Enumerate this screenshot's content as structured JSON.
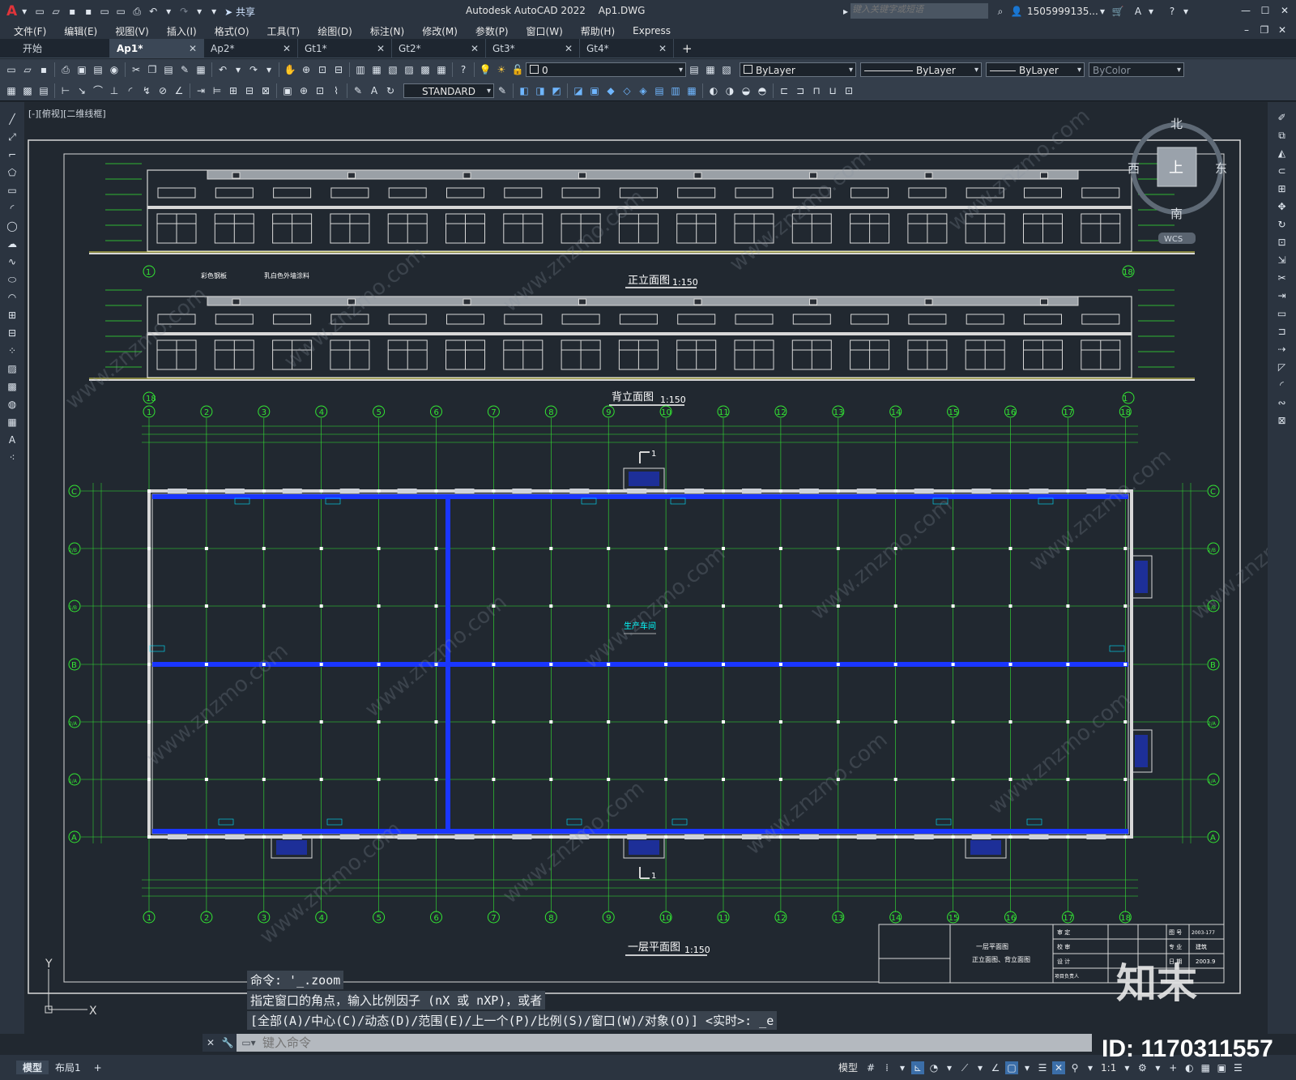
{
  "window": {
    "title": "Autodesk AutoCAD 2022",
    "file": "Ap1.DWG",
    "share": "共享",
    "search_placeholder": "键入关键字或短语",
    "user": "1505999135...",
    "app_letter": "A"
  },
  "menu": [
    "文件(F)",
    "编辑(E)",
    "视图(V)",
    "插入(I)",
    "格式(O)",
    "工具(T)",
    "绘图(D)",
    "标注(N)",
    "修改(M)",
    "参数(P)",
    "窗口(W)",
    "帮助(H)",
    "Express"
  ],
  "tabs": [
    {
      "label": "开始",
      "close": false,
      "active": false
    },
    {
      "label": "Ap1*",
      "close": true,
      "active": true
    },
    {
      "label": "Ap2*",
      "close": true,
      "active": false
    },
    {
      "label": "Gt1*",
      "close": true,
      "active": false
    },
    {
      "label": "Gt2*",
      "close": true,
      "active": false
    },
    {
      "label": "Gt3*",
      "close": true,
      "active": false
    },
    {
      "label": "Gt4*",
      "close": true,
      "active": false
    }
  ],
  "props": {
    "layer": "0",
    "color": "ByLayer",
    "linetype": "ByLayer",
    "lineweight": "ByLayer",
    "plotstyle": "ByColor",
    "textstyle": "STANDARD"
  },
  "view_label": "[-][俯视][二维线框]",
  "viewcube": {
    "n": "北",
    "s": "南",
    "e": "东",
    "w": "西",
    "top": "上",
    "wcs": "WCS"
  },
  "ucs": {
    "y": "Y",
    "x": "X"
  },
  "drawing": {
    "front_title": "正立面图",
    "front_scale": "1:150",
    "back_title": "背立面图",
    "back_scale": "1:150",
    "plan_title": "一层平面图",
    "plan_scale": "1:150",
    "room_label": "生产车间",
    "section_mark": "1",
    "axis_numbers": [
      "1",
      "2",
      "3",
      "4",
      "5",
      "6",
      "7",
      "8",
      "9",
      "10",
      "11",
      "12",
      "13",
      "14",
      "15",
      "16",
      "17",
      "18"
    ],
    "axis_letters": [
      "C",
      "2/B",
      "1/B",
      "B",
      "2/A",
      "1/A",
      "A"
    ],
    "elev_axis_start": "1",
    "elev_axis_end": "18",
    "note1": "彩色钢板",
    "note2": "乳白色外墙涂料",
    "title_block": {
      "drawing_name_1": "一层平面图",
      "drawing_name_2": "正立面图、背立面图",
      "no_label": "图 号",
      "no_value": "2003-177",
      "spec_label": "专 业",
      "spec_value": "建筑",
      "date_label": "日 期",
      "date_value": "2003.9",
      "approve": "审 定",
      "check": "校 审",
      "design": "设 计",
      "lead": "项目负责人"
    }
  },
  "command": {
    "history": [
      "命令: '_.zoom",
      "指定窗口的角点，输入比例因子 (nX 或 nXP)，或者",
      "[全部(A)/中心(C)/动态(D)/范围(E)/上一个(P)/比例(S)/窗口(W)/对象(O)] <实时>: _e"
    ],
    "placeholder": "键入命令"
  },
  "status": {
    "tabs": [
      "模型",
      "布局1"
    ],
    "add": "+",
    "mode": "模型",
    "scale": "1:1"
  },
  "watermark": {
    "brand": "知末",
    "id": "ID: 1170311557",
    "text": "www.znzmo.com"
  }
}
